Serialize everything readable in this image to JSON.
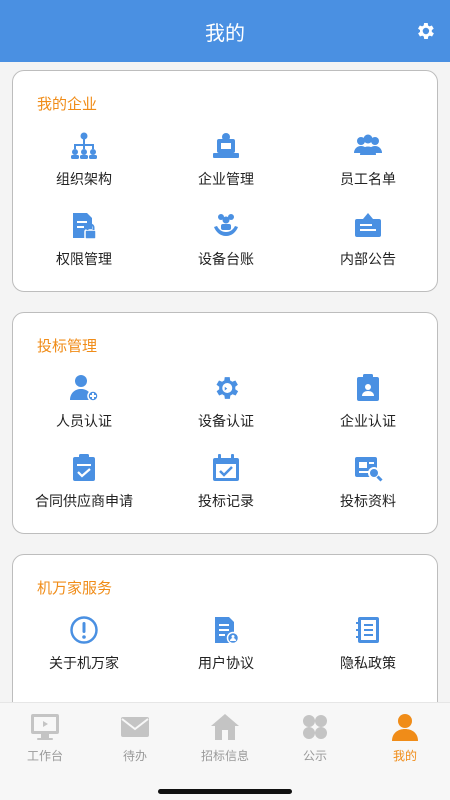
{
  "header": {
    "title": "我的"
  },
  "sections": [
    {
      "title": "我的企业",
      "items": [
        {
          "label": "组织架构",
          "icon": "org-structure"
        },
        {
          "label": "企业管理",
          "icon": "enterprise"
        },
        {
          "label": "员工名单",
          "icon": "staff-list"
        },
        {
          "label": "权限管理",
          "icon": "permission"
        },
        {
          "label": "设备台账",
          "icon": "device-ledger"
        },
        {
          "label": "内部公告",
          "icon": "announcement"
        }
      ]
    },
    {
      "title": "投标管理",
      "items": [
        {
          "label": "人员认证",
          "icon": "person-cert"
        },
        {
          "label": "设备认证",
          "icon": "device-cert"
        },
        {
          "label": "企业认证",
          "icon": "enterprise-cert"
        },
        {
          "label": "合同供应商申请",
          "icon": "contract-supplier"
        },
        {
          "label": "投标记录",
          "icon": "bid-record"
        },
        {
          "label": "投标资料",
          "icon": "bid-docs"
        }
      ]
    },
    {
      "title": "机万家服务",
      "items": [
        {
          "label": "关于机万家",
          "icon": "about"
        },
        {
          "label": "用户协议",
          "icon": "user-agreement"
        },
        {
          "label": "隐私政策",
          "icon": "privacy"
        }
      ]
    }
  ],
  "tabbar": {
    "items": [
      {
        "label": "工作台",
        "icon": "monitor"
      },
      {
        "label": "待办",
        "icon": "mail"
      },
      {
        "label": "招标信息",
        "icon": "home"
      },
      {
        "label": "公示",
        "icon": "clover"
      },
      {
        "label": "我的",
        "icon": "user"
      }
    ],
    "active_index": 4
  },
  "colors": {
    "primary": "#4a90e2",
    "accent": "#f08c18",
    "tab_inactive": "#c4c4c4"
  }
}
